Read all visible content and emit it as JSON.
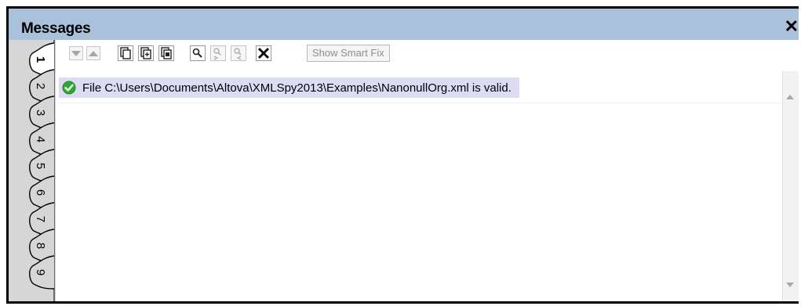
{
  "window": {
    "title": "Messages",
    "close_glyph": "✕"
  },
  "tabs": [
    {
      "label": "1",
      "active": true
    },
    {
      "label": "2"
    },
    {
      "label": "3"
    },
    {
      "label": "4"
    },
    {
      "label": "5"
    },
    {
      "label": "6"
    },
    {
      "label": "7"
    },
    {
      "label": "8"
    },
    {
      "label": "9"
    }
  ],
  "toolbar": {
    "buttons": [
      {
        "name": "next-error",
        "icon": "arrow-down-icon",
        "enabled": false
      },
      {
        "name": "previous-error",
        "icon": "arrow-up-icon",
        "enabled": false
      },
      {
        "name": "copy-line",
        "icon": "copy-icon",
        "enabled": true
      },
      {
        "name": "copy-all-expanded",
        "icon": "copy-all-icon",
        "enabled": true
      },
      {
        "name": "copy-all",
        "icon": "copy-plus-icon",
        "enabled": true
      },
      {
        "name": "find",
        "icon": "search-icon",
        "enabled": true
      },
      {
        "name": "find-next",
        "icon": "find-next-icon",
        "enabled": false
      },
      {
        "name": "find-previous",
        "icon": "find-previous-icon",
        "enabled": false
      },
      {
        "name": "clear",
        "icon": "clear-x-icon",
        "enabled": true
      }
    ],
    "smart_fix_label": "Show Smart Fix"
  },
  "messages": [
    {
      "status": "valid",
      "icon": "check-circle-icon",
      "text": "File C:\\Users\\Documents\\Altova\\XMLSpy2013\\Examples\\NanonullOrg.xml is valid."
    }
  ],
  "colors": {
    "titlebar": "#a9c1da",
    "selected_row": "#dcdcf4",
    "valid_icon": "#2eaa2e"
  }
}
